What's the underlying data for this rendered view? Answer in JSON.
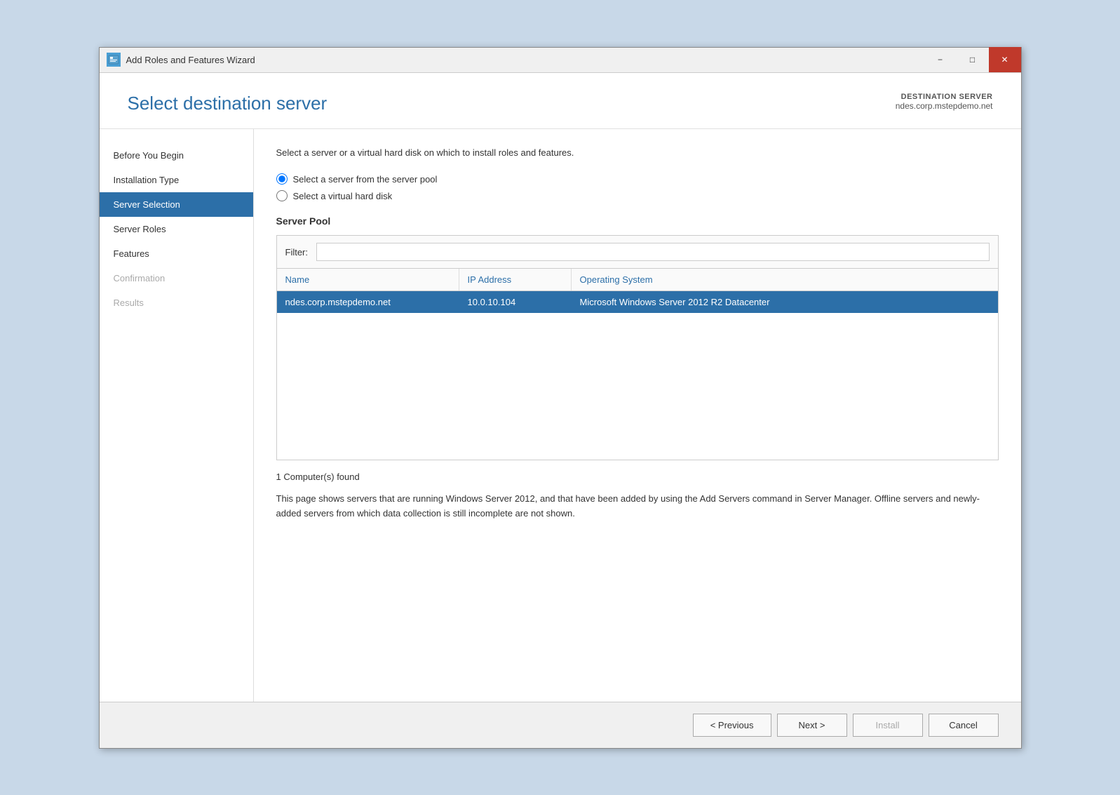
{
  "window": {
    "title": "Add Roles and Features Wizard",
    "icon": "wizard-icon"
  },
  "titlebar": {
    "minimize_label": "−",
    "maximize_label": "□",
    "close_label": "✕"
  },
  "header": {
    "page_title": "Select destination server",
    "destination_label": "DESTINATION SERVER",
    "destination_server": "ndes.corp.mstepdemo.net"
  },
  "sidebar": {
    "items": [
      {
        "label": "Before You Begin",
        "state": "normal"
      },
      {
        "label": "Installation Type",
        "state": "normal"
      },
      {
        "label": "Server Selection",
        "state": "active"
      },
      {
        "label": "Server Roles",
        "state": "normal"
      },
      {
        "label": "Features",
        "state": "normal"
      },
      {
        "label": "Confirmation",
        "state": "disabled"
      },
      {
        "label": "Results",
        "state": "disabled"
      }
    ]
  },
  "main": {
    "description": "Select a server or a virtual hard disk on which to install roles and features.",
    "radio_option_1": "Select a server from the server pool",
    "radio_option_2": "Select a virtual hard disk",
    "section_title": "Server Pool",
    "filter_label": "Filter:",
    "filter_placeholder": "",
    "table_columns": [
      "Name",
      "IP Address",
      "Operating System"
    ],
    "table_rows": [
      {
        "name": "ndes.corp.mstepdemo.net",
        "ip": "10.0.10.104",
        "os": "Microsoft Windows Server 2012 R2 Datacenter",
        "selected": true
      }
    ],
    "computers_found": "1 Computer(s) found",
    "info_text": "This page shows servers that are running Windows Server 2012, and that have been added by using the Add Servers command in Server Manager. Offline servers and newly-added servers from which data collection is still incomplete are not shown."
  },
  "footer": {
    "previous_label": "< Previous",
    "next_label": "Next >",
    "install_label": "Install",
    "cancel_label": "Cancel"
  }
}
